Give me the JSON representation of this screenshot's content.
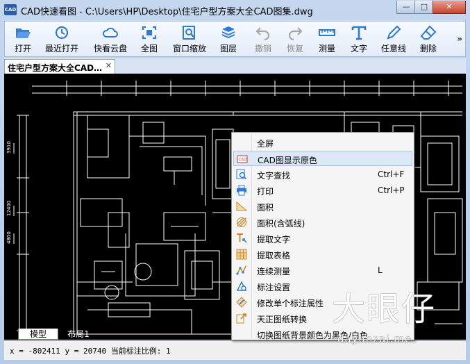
{
  "window": {
    "icon_text": "CAD",
    "title": "CAD快速看图 - C:\\Users\\HP\\Desktop\\住宅户型方案大全CAD图集.dwg",
    "controls": {
      "minimize": "—",
      "maximize": "□",
      "close": "✕"
    }
  },
  "toolbar": {
    "items": [
      {
        "label": "打开",
        "icon": "folder-open-icon",
        "enabled": true
      },
      {
        "label": "最近打开",
        "icon": "clock-icon",
        "enabled": true
      },
      {
        "label": "快看云盘",
        "icon": "cloud-icon",
        "enabled": true
      },
      {
        "label": "全图",
        "icon": "fullview-icon",
        "enabled": true
      },
      {
        "label": "窗口缩放",
        "icon": "zoom-window-icon",
        "enabled": true
      },
      {
        "label": "图层",
        "icon": "layers-icon",
        "enabled": true
      },
      {
        "label": "撤销",
        "icon": "undo-icon",
        "enabled": false
      },
      {
        "label": "恢复",
        "icon": "redo-icon",
        "enabled": false
      },
      {
        "label": "测量",
        "icon": "ruler-icon",
        "enabled": true
      },
      {
        "label": "文字",
        "icon": "text-icon",
        "enabled": true
      },
      {
        "label": "任意线",
        "icon": "pen-icon",
        "enabled": true
      },
      {
        "label": "删除",
        "icon": "eraser-icon",
        "enabled": true
      }
    ],
    "more": "»"
  },
  "tabs": {
    "document": "住宅户型方案大全CAD…",
    "close": "✕"
  },
  "layout_tabs": [
    "模型",
    "布局1"
  ],
  "status": {
    "text": "x = -802411 y = 20740 当前标注比例: 1"
  },
  "context_menu": {
    "items": [
      {
        "label": "全屏",
        "shortcut": "",
        "icon": "",
        "highlighted": false
      },
      {
        "label": "CAD图显示原色",
        "shortcut": "",
        "icon": "cad-color-icon",
        "highlighted": true
      },
      {
        "label": "文字查找",
        "shortcut": "Ctrl+F",
        "icon": "text-search-icon",
        "highlighted": false
      },
      {
        "label": "打印",
        "shortcut": "Ctrl+P",
        "icon": "printer-icon",
        "highlighted": false
      },
      {
        "label": "面积",
        "shortcut": "",
        "icon": "area-icon",
        "highlighted": false
      },
      {
        "label": "面积(含弧线)",
        "shortcut": "",
        "icon": "area-arc-icon",
        "highlighted": false
      },
      {
        "label": "提取文字",
        "shortcut": "",
        "icon": "extract-text-icon",
        "highlighted": false
      },
      {
        "label": "提取表格",
        "shortcut": "",
        "icon": "extract-table-icon",
        "highlighted": false
      },
      {
        "label": "连续测量",
        "shortcut": "L",
        "icon": "continuous-measure-icon",
        "highlighted": false
      },
      {
        "label": "标注设置",
        "shortcut": "",
        "icon": "dimension-settings-icon",
        "highlighted": false
      },
      {
        "label": "修改单个标注属性",
        "shortcut": "",
        "icon": "edit-dimension-icon",
        "highlighted": false
      },
      {
        "label": "天正图纸转换",
        "shortcut": "",
        "icon": "convert-icon",
        "highlighted": false
      },
      {
        "label": "切换图纸背景颜色为黑色/白色",
        "shortcut": "",
        "icon": "",
        "highlighted": false
      }
    ]
  },
  "watermark": {
    "big": "大眼仔",
    "small": "dayanzai.me"
  }
}
